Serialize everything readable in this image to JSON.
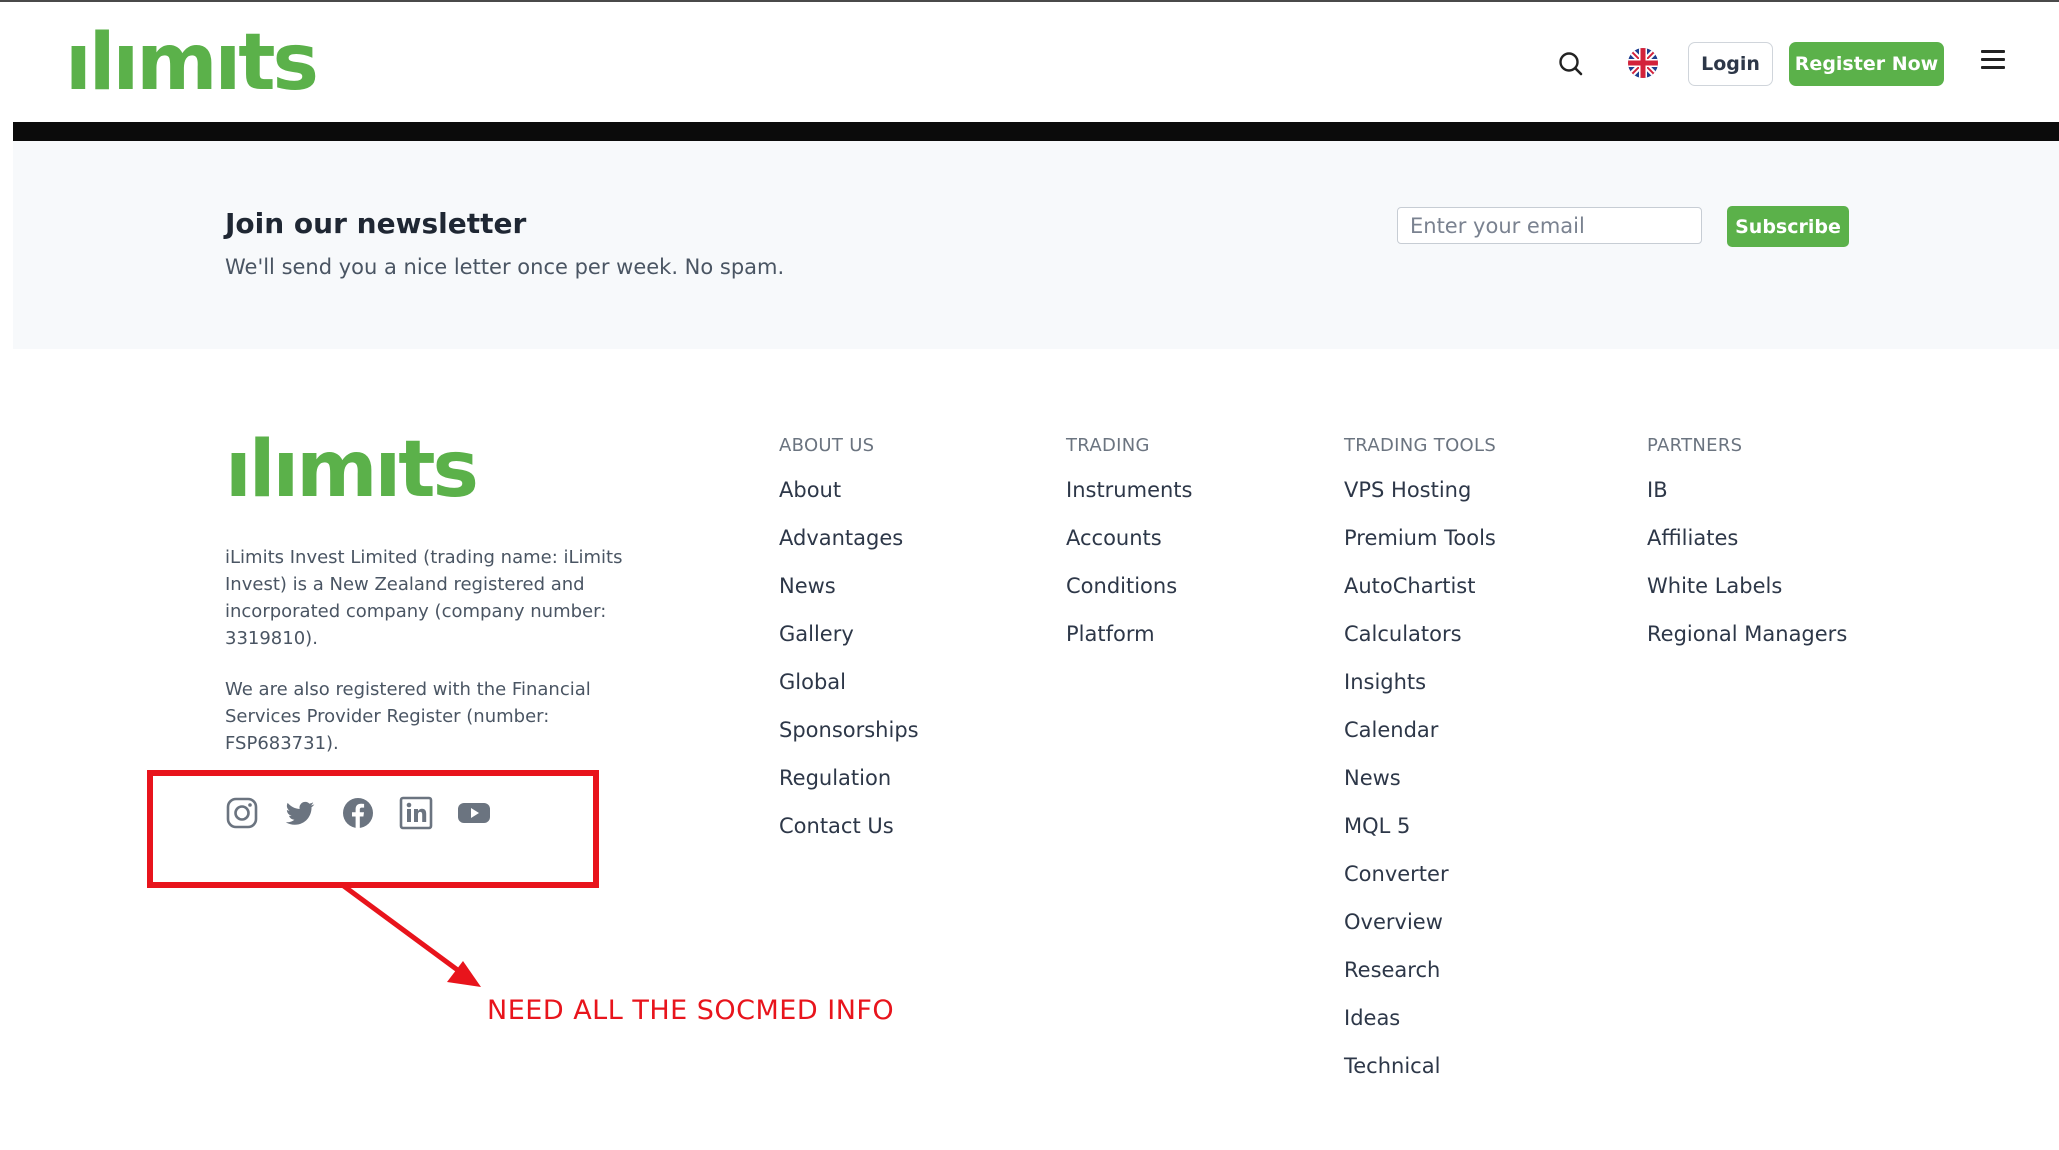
{
  "header": {
    "logo_text": "ılımıts",
    "login_label": "Login",
    "register_label": "Register Now"
  },
  "newsletter": {
    "title": "Join our newsletter",
    "subtitle": "We'll send you a nice letter once per week. No spam.",
    "email_placeholder": "Enter your email",
    "subscribe_label": "Subscribe"
  },
  "footer": {
    "logo_text": "ılımıts",
    "company_text": "iLimits Invest Limited (trading name: iLimits Invest) is a New Zealand registered and incorporated company (company number: 3319810).",
    "register_text": "We are also registered with the Financial Services Provider Register (number: FSP683731).",
    "social": [
      "instagram-icon",
      "twitter-icon",
      "facebook-icon",
      "linkedin-icon",
      "youtube-icon"
    ],
    "columns": [
      {
        "heading": "ABOUT US",
        "links": [
          "About",
          "Advantages",
          "News",
          "Gallery",
          "Global",
          "Sponsorships",
          "Regulation",
          "Contact Us"
        ]
      },
      {
        "heading": "TRADING",
        "links": [
          "Instruments",
          "Accounts",
          "Conditions",
          "Platform"
        ]
      },
      {
        "heading": "TRADING TOOLS",
        "links": [
          "VPS Hosting",
          "Premium Tools",
          "AutoChartist",
          "Calculators",
          "Insights",
          "Calendar",
          "News",
          "MQL 5",
          "Converter",
          "Overview",
          "Research",
          "Ideas",
          "Technical"
        ]
      },
      {
        "heading": "PARTNERS",
        "links": [
          "IB",
          "Affiliates",
          "White Labels",
          "Regional Managers"
        ]
      }
    ]
  },
  "annotation": {
    "text": "NEED ALL THE SOCMED INFO"
  },
  "colors": {
    "brand_green": "#5bb14a",
    "annotation_red": "#e8141c"
  }
}
